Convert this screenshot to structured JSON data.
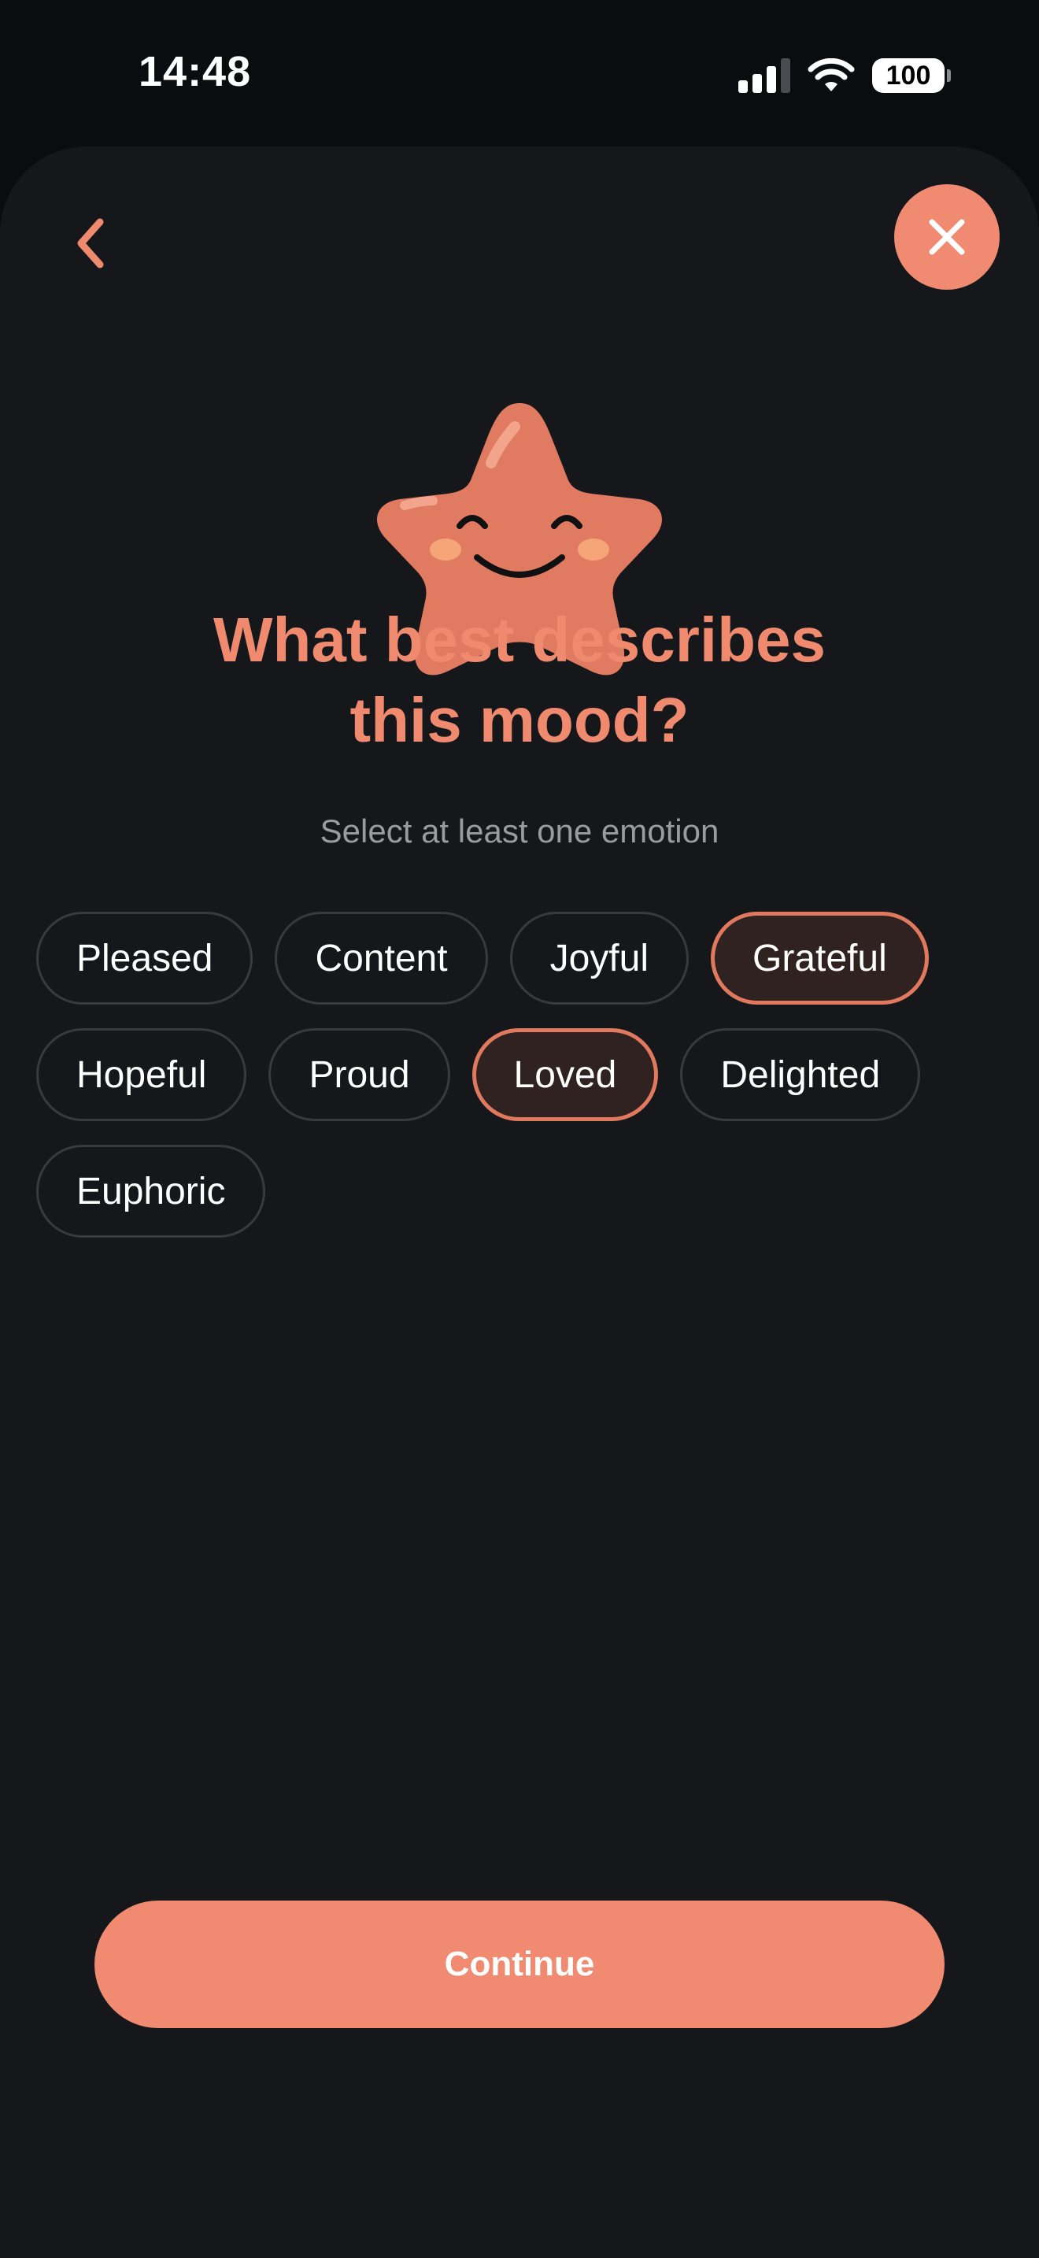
{
  "status_bar": {
    "time": "14:48",
    "battery": "100",
    "icons": [
      "cellular-signal-icon",
      "wifi-icon",
      "battery-icon"
    ]
  },
  "header": {
    "back_icon": "chevron-left-icon",
    "close_icon": "close-icon"
  },
  "mascot": {
    "icon": "smiling-star-mascot"
  },
  "title": {
    "line1": "What best describes",
    "line2": "this mood?"
  },
  "subtitle": "Select at least one emotion",
  "emotions": [
    {
      "label": "Pleased",
      "selected": false
    },
    {
      "label": "Content",
      "selected": false
    },
    {
      "label": "Joyful",
      "selected": false
    },
    {
      "label": "Grateful",
      "selected": true
    },
    {
      "label": "Hopeful",
      "selected": false
    },
    {
      "label": "Proud",
      "selected": false
    },
    {
      "label": "Loved",
      "selected": true
    },
    {
      "label": "Delighted",
      "selected": false
    },
    {
      "label": "Euphoric",
      "selected": false
    }
  ],
  "continue_label": "Continue",
  "colors": {
    "accent": "#f08a70",
    "title": "#ef8a6e",
    "background": "#16171b",
    "chip_border": "#393a3f",
    "chip_selected_border": "#e0795d",
    "chip_selected_bg": "#2f2221"
  }
}
